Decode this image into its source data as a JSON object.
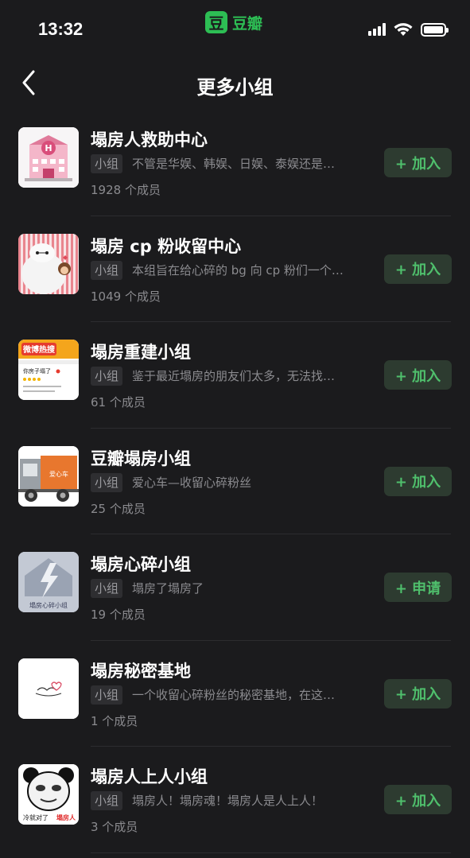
{
  "status_bar": {
    "time": "13:32",
    "app_logo": "豆",
    "app_name": "豆瓣"
  },
  "nav": {
    "title": "更多小组"
  },
  "groups": [
    {
      "name": "塌房人救助中心",
      "tag": "小组",
      "desc": "不管是华娱、韩娱、日娱、泰娱还是…",
      "members": "1928 个成员",
      "action": "+ 加入"
    },
    {
      "name": "塌房 cp 粉收留中心",
      "tag": "小组",
      "desc": "本组旨在给心碎的 bg 向 cp 粉们一个…",
      "members": "1049 个成员",
      "action": "+ 加入"
    },
    {
      "name": "塌房重建小组",
      "tag": "小组",
      "desc": "鉴于最近塌房的朋友们太多，无法找…",
      "members": "61 个成员",
      "action": "+ 加入"
    },
    {
      "name": "豆瓣塌房小组",
      "tag": "小组",
      "desc": "爱心车—收留心碎粉丝",
      "members": "25 个成员",
      "action": "+ 加入"
    },
    {
      "name": "塌房心碎小组",
      "tag": "小组",
      "desc": "塌房了塌房了",
      "members": "19 个成员",
      "action": "+ 申请"
    },
    {
      "name": "塌房秘密基地",
      "tag": "小组",
      "desc": "一个收留心碎粉丝的秘密基地，在这…",
      "members": "1 个成员",
      "action": "+ 加入"
    },
    {
      "name": "塌房人上人小组",
      "tag": "小组",
      "desc": "塌房人！塌房魂！塌房人是人上人！",
      "members": "3 个成员",
      "action": "+ 加入"
    }
  ],
  "thumb_text": {
    "weibo_label": "微博热搜",
    "weibo_post": "你房子塌了",
    "truck_label": "爱心车",
    "house_label": "塌房心碎小组",
    "meme_caption_1": "冷就对了",
    "meme_caption_2": "塌房人"
  },
  "colors": {
    "background": "#1b1b1d",
    "accent_green": "#4fbf6c",
    "button_bg": "#2d3b30",
    "brand_green": "#2dbe54"
  }
}
